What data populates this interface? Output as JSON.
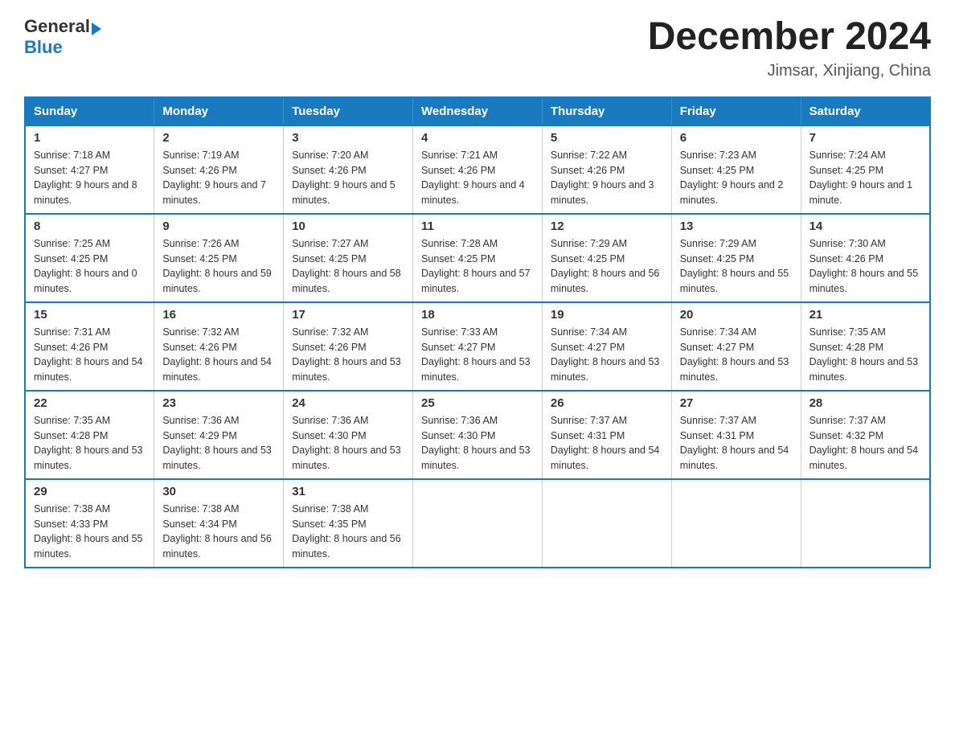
{
  "header": {
    "logo_general": "General",
    "logo_blue": "Blue",
    "title": "December 2024",
    "subtitle": "Jimsar, Xinjiang, China"
  },
  "days_of_week": [
    "Sunday",
    "Monday",
    "Tuesday",
    "Wednesday",
    "Thursday",
    "Friday",
    "Saturday"
  ],
  "weeks": [
    [
      {
        "day": "1",
        "sunrise": "7:18 AM",
        "sunset": "4:27 PM",
        "daylight": "9 hours and 8 minutes."
      },
      {
        "day": "2",
        "sunrise": "7:19 AM",
        "sunset": "4:26 PM",
        "daylight": "9 hours and 7 minutes."
      },
      {
        "day": "3",
        "sunrise": "7:20 AM",
        "sunset": "4:26 PM",
        "daylight": "9 hours and 5 minutes."
      },
      {
        "day": "4",
        "sunrise": "7:21 AM",
        "sunset": "4:26 PM",
        "daylight": "9 hours and 4 minutes."
      },
      {
        "day": "5",
        "sunrise": "7:22 AM",
        "sunset": "4:26 PM",
        "daylight": "9 hours and 3 minutes."
      },
      {
        "day": "6",
        "sunrise": "7:23 AM",
        "sunset": "4:25 PM",
        "daylight": "9 hours and 2 minutes."
      },
      {
        "day": "7",
        "sunrise": "7:24 AM",
        "sunset": "4:25 PM",
        "daylight": "9 hours and 1 minute."
      }
    ],
    [
      {
        "day": "8",
        "sunrise": "7:25 AM",
        "sunset": "4:25 PM",
        "daylight": "8 hours and 0 minutes."
      },
      {
        "day": "9",
        "sunrise": "7:26 AM",
        "sunset": "4:25 PM",
        "daylight": "8 hours and 59 minutes."
      },
      {
        "day": "10",
        "sunrise": "7:27 AM",
        "sunset": "4:25 PM",
        "daylight": "8 hours and 58 minutes."
      },
      {
        "day": "11",
        "sunrise": "7:28 AM",
        "sunset": "4:25 PM",
        "daylight": "8 hours and 57 minutes."
      },
      {
        "day": "12",
        "sunrise": "7:29 AM",
        "sunset": "4:25 PM",
        "daylight": "8 hours and 56 minutes."
      },
      {
        "day": "13",
        "sunrise": "7:29 AM",
        "sunset": "4:25 PM",
        "daylight": "8 hours and 55 minutes."
      },
      {
        "day": "14",
        "sunrise": "7:30 AM",
        "sunset": "4:26 PM",
        "daylight": "8 hours and 55 minutes."
      }
    ],
    [
      {
        "day": "15",
        "sunrise": "7:31 AM",
        "sunset": "4:26 PM",
        "daylight": "8 hours and 54 minutes."
      },
      {
        "day": "16",
        "sunrise": "7:32 AM",
        "sunset": "4:26 PM",
        "daylight": "8 hours and 54 minutes."
      },
      {
        "day": "17",
        "sunrise": "7:32 AM",
        "sunset": "4:26 PM",
        "daylight": "8 hours and 53 minutes."
      },
      {
        "day": "18",
        "sunrise": "7:33 AM",
        "sunset": "4:27 PM",
        "daylight": "8 hours and 53 minutes."
      },
      {
        "day": "19",
        "sunrise": "7:34 AM",
        "sunset": "4:27 PM",
        "daylight": "8 hours and 53 minutes."
      },
      {
        "day": "20",
        "sunrise": "7:34 AM",
        "sunset": "4:27 PM",
        "daylight": "8 hours and 53 minutes."
      },
      {
        "day": "21",
        "sunrise": "7:35 AM",
        "sunset": "4:28 PM",
        "daylight": "8 hours and 53 minutes."
      }
    ],
    [
      {
        "day": "22",
        "sunrise": "7:35 AM",
        "sunset": "4:28 PM",
        "daylight": "8 hours and 53 minutes."
      },
      {
        "day": "23",
        "sunrise": "7:36 AM",
        "sunset": "4:29 PM",
        "daylight": "8 hours and 53 minutes."
      },
      {
        "day": "24",
        "sunrise": "7:36 AM",
        "sunset": "4:30 PM",
        "daylight": "8 hours and 53 minutes."
      },
      {
        "day": "25",
        "sunrise": "7:36 AM",
        "sunset": "4:30 PM",
        "daylight": "8 hours and 53 minutes."
      },
      {
        "day": "26",
        "sunrise": "7:37 AM",
        "sunset": "4:31 PM",
        "daylight": "8 hours and 54 minutes."
      },
      {
        "day": "27",
        "sunrise": "7:37 AM",
        "sunset": "4:31 PM",
        "daylight": "8 hours and 54 minutes."
      },
      {
        "day": "28",
        "sunrise": "7:37 AM",
        "sunset": "4:32 PM",
        "daylight": "8 hours and 54 minutes."
      }
    ],
    [
      {
        "day": "29",
        "sunrise": "7:38 AM",
        "sunset": "4:33 PM",
        "daylight": "8 hours and 55 minutes."
      },
      {
        "day": "30",
        "sunrise": "7:38 AM",
        "sunset": "4:34 PM",
        "daylight": "8 hours and 56 minutes."
      },
      {
        "day": "31",
        "sunrise": "7:38 AM",
        "sunset": "4:35 PM",
        "daylight": "8 hours and 56 minutes."
      },
      null,
      null,
      null,
      null
    ]
  ],
  "labels": {
    "sunrise": "Sunrise:",
    "sunset": "Sunset:",
    "daylight": "Daylight:"
  }
}
